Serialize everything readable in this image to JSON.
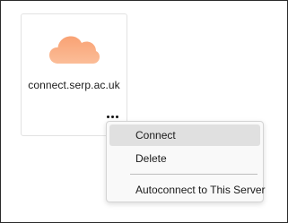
{
  "server_card": {
    "name": "connect.serp.ac.uk",
    "icon": "cloud-icon",
    "more_button_icon": "more-dots-icon",
    "cloud_color_top": "#f9a274",
    "cloud_color_bottom": "#fbbd98"
  },
  "context_menu": {
    "items": [
      {
        "label": "Connect",
        "highlighted": true
      },
      {
        "label": "Delete",
        "highlighted": false
      },
      {
        "label": "Autoconnect to This Server",
        "highlighted": false
      }
    ]
  }
}
